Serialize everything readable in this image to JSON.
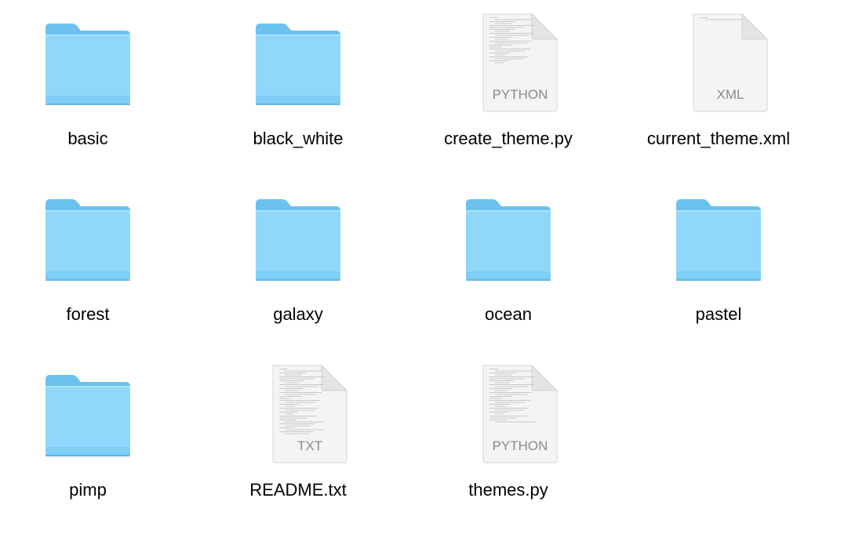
{
  "colors": {
    "folder_back": "#6cc2ee",
    "folder_front": "#8fd8fb",
    "folder_front_bottom": "#7ccdf5",
    "doc_bg": "#f4f4f4",
    "doc_fold": "#e4e4e4",
    "doc_label": "#8a8a8a"
  },
  "items": [
    {
      "name": "basic",
      "kind": "folder",
      "icon": "folder-icon"
    },
    {
      "name": "black_white",
      "kind": "folder",
      "icon": "folder-icon"
    },
    {
      "name": "create_theme.py",
      "kind": "document",
      "icon": "python-file-icon",
      "badge": "PYTHON",
      "text_lines": 24
    },
    {
      "name": "current_theme.xml",
      "kind": "document",
      "icon": "xml-file-icon",
      "badge": "XML",
      "text_lines": 2
    },
    {
      "name": "forest",
      "kind": "folder",
      "icon": "folder-icon"
    },
    {
      "name": "galaxy",
      "kind": "folder",
      "icon": "folder-icon"
    },
    {
      "name": "ocean",
      "kind": "folder",
      "icon": "folder-icon"
    },
    {
      "name": "pastel",
      "kind": "folder",
      "icon": "folder-icon"
    },
    {
      "name": "pimp",
      "kind": "folder",
      "icon": "folder-icon"
    },
    {
      "name": "README.txt",
      "kind": "document",
      "icon": "text-file-icon",
      "badge": "TXT",
      "text_lines": 40
    },
    {
      "name": "themes.py",
      "kind": "document",
      "icon": "python-file-icon",
      "badge": "PYTHON",
      "text_lines": 28
    }
  ]
}
